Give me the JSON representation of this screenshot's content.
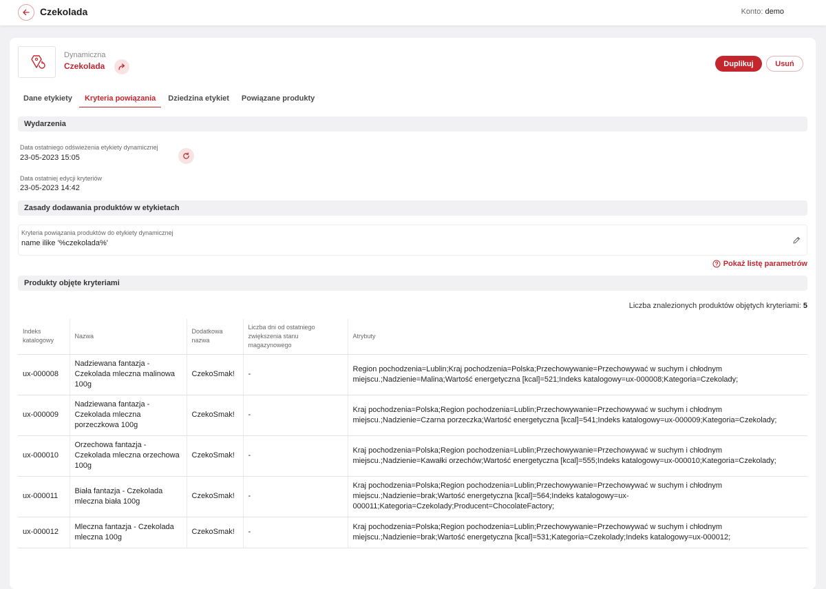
{
  "header": {
    "title": "Czekolada",
    "account_label": "Konto:",
    "account_value": "demo"
  },
  "label": {
    "type": "Dynamiczna",
    "name": "Czekolada"
  },
  "actions": {
    "duplicate": "Duplikuj",
    "delete": "Usuń"
  },
  "tabs": [
    {
      "label": "Dane etykiety",
      "active": false
    },
    {
      "label": "Kryteria powiązania",
      "active": true
    },
    {
      "label": "Dziedzina etykiet",
      "active": false
    },
    {
      "label": "Powiązane produkty",
      "active": false
    }
  ],
  "events": {
    "title": "Wydarzenia",
    "refresh_label": "Data ostatniego odświeżenia etykiety dynamicznej",
    "refresh_value": "23-05-2023 15:05",
    "edit_label": "Data ostatniej edycji kryteriów",
    "edit_value": "23-05-2023 14:42"
  },
  "rules": {
    "title": "Zasady dodawania produktów w etykietach",
    "criteria_label": "Kryteria powiązania produktów do etykiety dynamicznej",
    "criteria_value": "name ilike '%czekolada%'",
    "params_link": "Pokaż listę parametrów"
  },
  "products": {
    "title": "Produkty objęte kryteriami",
    "count_label": "Liczba znalezionych produktów objętych kryteriami:",
    "count_value": "5",
    "columns": [
      "Indeks katalogowy",
      "Nazwa",
      "Dodatkowa nazwa",
      "Liczba dni od ostatniego zwiększenia stanu magazynowego",
      "Atrybuty"
    ],
    "rows": [
      [
        "ux-000008",
        "Nadziewana fantazja - Czekolada mleczna malinowa 100g",
        "CzekoSmak!",
        "-",
        "Region pochodzenia=Lublin;Kraj pochodzenia=Polska;Przechowywanie=Przechowywać w suchym i chłodnym miejscu.;Nadzienie=Malina;Wartość energetyczna [kcal]=521;Indeks katalogowy=ux-000008;Kategoria=Czekolady;"
      ],
      [
        "ux-000009",
        "Nadziewana fantazja - Czekolada mleczna porzeczkowa 100g",
        "CzekoSmak!",
        "-",
        "Kraj pochodzenia=Polska;Region pochodzenia=Lublin;Przechowywanie=Przechowywać w suchym i chłodnym miejscu.;Nadzienie=Czarna porzeczka;Wartość energetyczna [kcal]=541;Indeks katalogowy=ux-000009;Kategoria=Czekolady;"
      ],
      [
        "ux-000010",
        "Orzechowa fantazja - Czekolada mleczna orzechowa 100g",
        "CzekoSmak!",
        "-",
        "Kraj pochodzenia=Polska;Region pochodzenia=Lublin;Przechowywanie=Przechowywać w suchym i chłodnym miejscu.;Nadzienie=Kawałki orzechów;Wartość energetyczna [kcal]=555;Indeks katalogowy=ux-000010;Kategoria=Czekolady;"
      ],
      [
        "ux-000011",
        "Biała fantazja - Czekolada mleczna biała 100g",
        "CzekoSmak!",
        "-",
        "Kraj pochodzenia=Polska;Region pochodzenia=Lublin;Przechowywanie=Przechowywać w suchym i chłodnym miejscu.;Nadzienie=brak;Wartość energetyczna [kcal]=564;Indeks katalogowy=ux-000011;Kategoria=Czekolady;Producent=ChocolateFactory;"
      ],
      [
        "ux-000012",
        "Mleczna fantazja - Czekolada mleczna 100g",
        "CzekoSmak!",
        "-",
        "Kraj pochodzenia=Polska;Region pochodzenia=Lublin;Przechowywanie=Przechowywać w suchym i chłodnym miejscu.;Nadzienie=brak;Wartość energetyczna [kcal]=531;Kategoria=Czekolady;Indeks katalogowy=ux-000012;"
      ]
    ]
  },
  "icons": {
    "back": "arrow-left-icon",
    "label": "label-tag-icon",
    "share": "share-arrow-icon",
    "refresh": "refresh-icon",
    "edit": "pencil-icon",
    "help": "question-circle-icon"
  },
  "colors": {
    "accent": "#c4262e",
    "background": "#f1f1f3"
  }
}
